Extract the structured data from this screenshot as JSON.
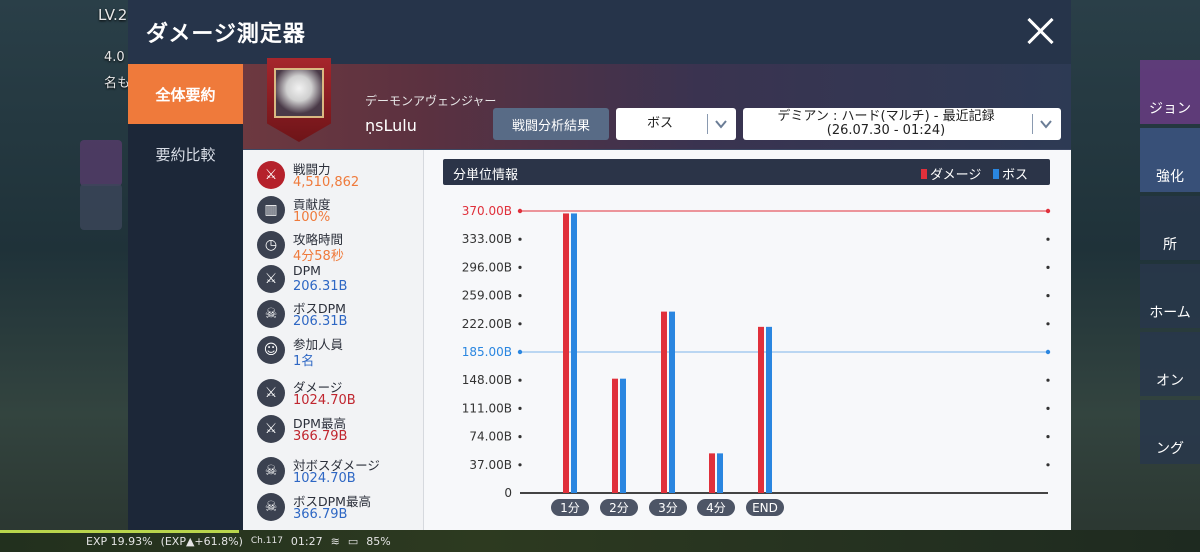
{
  "background": {
    "level_text": "LV.2",
    "combat_text": "4.0",
    "name_text": "名も",
    "right_labels": [
      "ジョン",
      "強化",
      "所",
      "ホーム",
      "オン",
      "ング"
    ]
  },
  "status_bar": {
    "exp_text": "EXP 19.93%",
    "exp_gain_text": "(EXP▲+61.8%)",
    "channel": "Ch.117",
    "clock": "01:27",
    "battery": "85%"
  },
  "modal": {
    "title": "ダメージ測定器",
    "tabs": [
      {
        "label": "全体要約",
        "active": true
      },
      {
        "label": "要約比較",
        "active": false
      }
    ]
  },
  "character": {
    "job": "デーモンアヴェンジャー",
    "name": "ṇsLulu",
    "analysis_button": "戦闘分析結果",
    "boss_select": "ボス",
    "record_select_line1": "デミアン : ハード(マルチ) - 最近記録",
    "record_select_line2": "(26.07.30 - 01:24)"
  },
  "stats": [
    {
      "label": "戦闘力",
      "value": "4,510,862",
      "color": "orange",
      "icon": "crossed-swords-icon",
      "glyph": "⚔",
      "red": true
    },
    {
      "label": "貢献度",
      "value": "100%",
      "color": "orange",
      "icon": "bar-chart-icon",
      "glyph": "▥",
      "red": false
    },
    {
      "label": "攻略時間",
      "value": "4分58秒",
      "color": "orange",
      "icon": "clock-icon",
      "glyph": "◷",
      "red": false
    },
    {
      "label": "DPM",
      "value": "206.31B",
      "color": "blue",
      "icon": "sword-icon",
      "glyph": "⚔",
      "red": false
    },
    {
      "label": "ボスDPM",
      "value": "206.31B",
      "color": "blue",
      "icon": "skull-icon",
      "glyph": "☠",
      "red": false
    },
    {
      "label": "参加人員",
      "value": "1名",
      "color": "blue",
      "icon": "person-icon",
      "glyph": "☺",
      "red": false
    },
    {
      "label": "ダメージ",
      "value": "1024.70B",
      "color": "red",
      "icon": "sword-icon",
      "glyph": "⚔",
      "red": false
    },
    {
      "label": "DPM最高",
      "value": "366.79B",
      "color": "red",
      "icon": "sword-up-icon",
      "glyph": "⚔",
      "red": false
    },
    {
      "label": "対ボスダメージ",
      "value": "1024.70B",
      "color": "blue",
      "icon": "skull-icon",
      "glyph": "☠",
      "red": false
    },
    {
      "label": "ボスDPM最高",
      "value": "366.79B",
      "color": "blue",
      "icon": "skull-icon",
      "glyph": "☠",
      "red": false
    }
  ],
  "chart_header": {
    "title": "分単位情報",
    "legend_damage": "ダメージ",
    "legend_boss": "ボス"
  },
  "chart_data": {
    "type": "bar",
    "title": "分単位情報",
    "categories": [
      "1分",
      "2分",
      "3分",
      "4分",
      "END"
    ],
    "series": [
      {
        "name": "ダメージ",
        "color": "#e0303b",
        "values": [
          366.79,
          150.0,
          238.0,
          52.0,
          218.0
        ]
      },
      {
        "name": "ボス",
        "color": "#2a86e0",
        "values": [
          366.79,
          150.0,
          238.0,
          52.0,
          218.0
        ]
      }
    ],
    "ylim": [
      0,
      370
    ],
    "yticks": [
      {
        "v": 370,
        "label": "370.00B"
      },
      {
        "v": 333,
        "label": "333.00B"
      },
      {
        "v": 296,
        "label": "296.00B"
      },
      {
        "v": 259,
        "label": "259.00B"
      },
      {
        "v": 222,
        "label": "222.00B"
      },
      {
        "v": 185,
        "label": "185.00B"
      },
      {
        "v": 148,
        "label": "148.00B"
      },
      {
        "v": 111,
        "label": "111.00B"
      },
      {
        "v": 74,
        "label": "74.00B"
      },
      {
        "v": 37,
        "label": "37.00B"
      },
      {
        "v": 0,
        "label": "0"
      }
    ],
    "max_line_color": "#e0303b",
    "avg_line_color": "#2a86e0",
    "max_value": 370,
    "avg_value": 185,
    "legend_position": "top-right"
  }
}
